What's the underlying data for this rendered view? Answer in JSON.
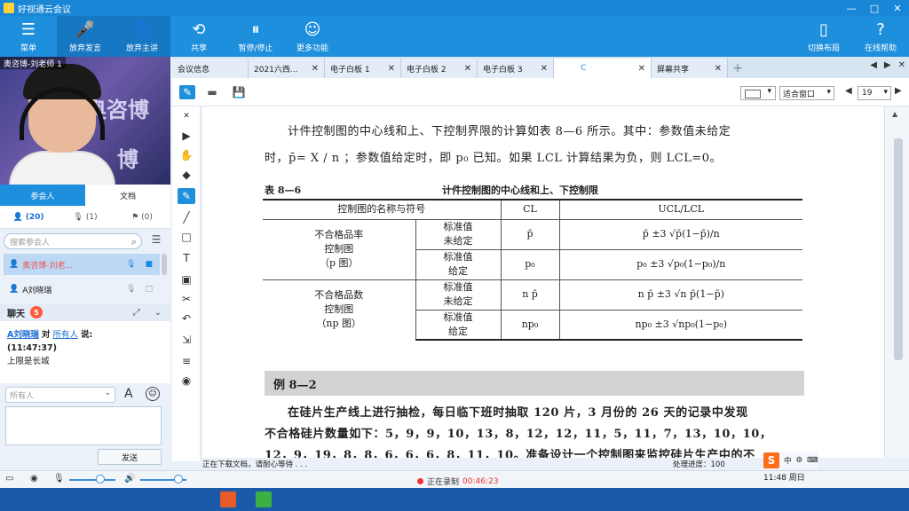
{
  "window": {
    "title": "好视通云会议",
    "controls": [
      "—",
      "□",
      "✕"
    ]
  },
  "toolbar": {
    "left": [
      {
        "label": "菜单",
        "icon": "menu-icon",
        "glyph": "☰"
      },
      {
        "label": "放弃发言",
        "icon": "microphone-icon",
        "glyph": "🎤"
      },
      {
        "label": "放弃主讲",
        "icon": "presenter-icon",
        "glyph": "👤"
      },
      {
        "label": "共享",
        "icon": "share-icon",
        "glyph": "⟲"
      },
      {
        "label": "暂停/停止",
        "icon": "pause-stop-icon",
        "glyph": "⏸"
      },
      {
        "label": "更多功能",
        "icon": "more-features-icon",
        "glyph": "☺"
      }
    ],
    "right": [
      {
        "label": "切换布局",
        "icon": "layout-icon",
        "glyph": "▯"
      },
      {
        "label": "在线帮助",
        "icon": "help-icon",
        "glyph": "?"
      }
    ]
  },
  "video": {
    "tag": "奥咨博-刘老师 1",
    "bg_text_1": "奥咨博",
    "bg_text_2": "博"
  },
  "panel": {
    "tabs": [
      "参会人",
      "文档"
    ],
    "counts": [
      {
        "icon": "person-icon",
        "glyph": "👤",
        "value": "(20)"
      },
      {
        "icon": "mic-count-icon",
        "glyph": "🎙",
        "value": "(1)"
      },
      {
        "icon": "hand-icon",
        "glyph": "⚑",
        "value": "(0)"
      }
    ],
    "search_placeholder": "搜索参会人",
    "participants": [
      {
        "name": "奥咨博-刘老...",
        "highlight": true
      },
      {
        "name": "A刘晓瑞",
        "highlight": false
      }
    ]
  },
  "chat": {
    "title": "聊天",
    "badge": "5",
    "sender": "A刘晓瑞",
    "to_word": "对",
    "recipient": "所有人",
    "say": "说:",
    "time": "(11:47:37)",
    "message": "上限是长城",
    "target_placeholder": "所有人",
    "font_icon": "A",
    "send_label": "发送"
  },
  "doc_tabs": [
    {
      "label": "会议信息",
      "active": false
    },
    {
      "label": "2021六西...",
      "active": false
    },
    {
      "label": "电子白板 1",
      "active": false
    },
    {
      "label": "电子白板 2",
      "active": false
    },
    {
      "label": "电子白板 3",
      "active": false
    },
    {
      "label": "C",
      "active": true
    },
    {
      "label": "屏幕共享",
      "active": false
    }
  ],
  "doc_toolbar": {
    "fit_option": "适合窗口",
    "page_number": "19"
  },
  "document": {
    "para1_line1": "计件控制图的中心线和上、下控制界限的计算如表 8—6 所示。其中：参数值未给定",
    "para1_line2": "时，p̄= X / n ；参数值给定时，即 p₀ 已知。如果 LCL 计算结果为负，则 LCL=0。",
    "table_no": "表 8—6",
    "table_title": "计件控制图的中心线和上、下控制限",
    "table_headers": [
      "控制图的名称与符号",
      "CL",
      "UCL/LCL"
    ],
    "group1": "不合格品率\n控制图\n（p 图）",
    "group2": "不合格品数\n控制图\n（np 图）",
    "rows": [
      {
        "cond": "标准值\n未给定",
        "cl": "p̄",
        "ucl": "p̄ ±3 √p̄(1−p̄)/n"
      },
      {
        "cond": "标准值\n给定",
        "cl": "p₀",
        "ucl": "p₀ ±3 √p₀(1−p₀)/n"
      },
      {
        "cond": "标准值\n未给定",
        "cl": "n p̄",
        "ucl": "n p̄ ±3 √n p̄(1−p̄)"
      },
      {
        "cond": "标准值\n给定",
        "cl": "np₀",
        "ucl": "np₀ ±3 √np₀(1−p₀)"
      }
    ],
    "example_title": "例 8—2",
    "para2_line1": "在硅片生产线上进行抽检，每日临下班时抽取 120 片，3 月份的 26 天的记录中发现",
    "para2_line2": "不合格硅片数量如下：5，9，9，10，13，8，12，12，11，5，11，7，13，10，10，",
    "para2_line3": "12，9，19，8，8，6，6，6，8，11，10。准备设计一个控制图来监控硅片生产中的不"
  },
  "status": {
    "left": "正在下载文档，请耐心等待 . . .",
    "progress_label": "处理进度：",
    "progress_value": "100",
    "ime": "中",
    "recording": "正在录制",
    "rec_time": "00:46:23",
    "clock": "11:48 周日"
  },
  "colors": {
    "primary": "#1e8fdc",
    "recording": "#ee3333"
  }
}
